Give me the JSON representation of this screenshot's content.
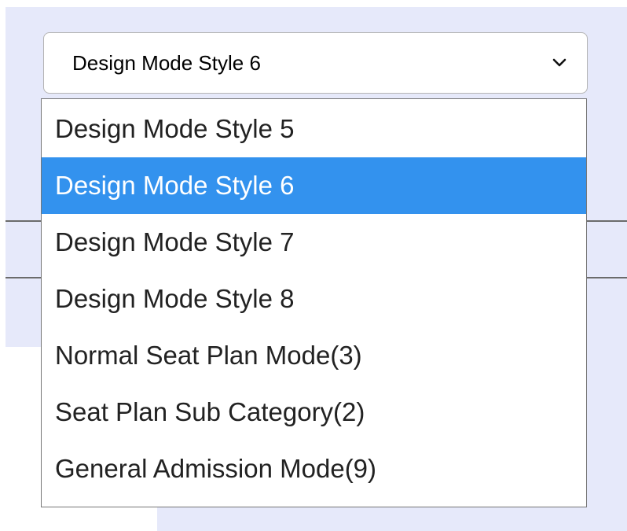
{
  "select": {
    "value": "Design Mode Style 6",
    "chevron_icon": "chevron-down-icon"
  },
  "dropdown": {
    "options": [
      {
        "label": "Design Mode Style 5",
        "selected": false
      },
      {
        "label": "Design Mode Style 6",
        "selected": true
      },
      {
        "label": "Design Mode Style 7",
        "selected": false
      },
      {
        "label": "Design Mode Style 8",
        "selected": false
      },
      {
        "label": "Normal Seat Plan Mode(3)",
        "selected": false
      },
      {
        "label": "Seat Plan Sub Category(2)",
        "selected": false
      },
      {
        "label": "General Admission Mode(9)",
        "selected": false
      }
    ]
  },
  "colors": {
    "background_panel": "#e6e9fa",
    "selected_option_bg": "#3392ee",
    "selected_option_text": "#ffffff",
    "option_text": "#222222"
  }
}
